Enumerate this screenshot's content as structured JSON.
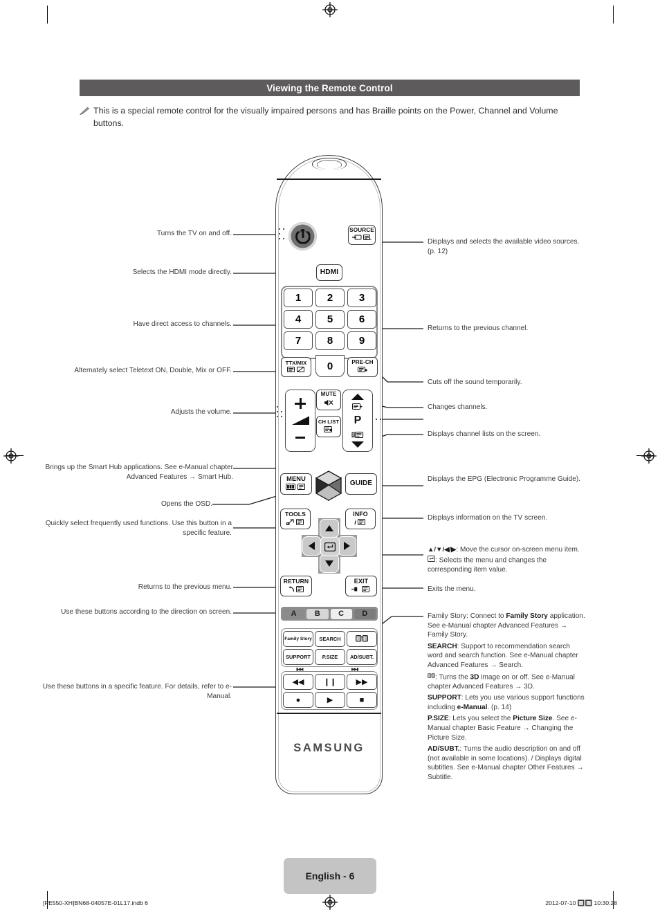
{
  "header": {
    "title": "Viewing the Remote Control"
  },
  "note": {
    "icon": "pencil-note-icon",
    "text": "This is a special remote control for the visually impaired persons and has Braille points on the Power, Channel and Volume buttons."
  },
  "labels_left": [
    {
      "id": "power",
      "text": "Turns the TV on and off."
    },
    {
      "id": "hdmi",
      "text": "Selects the HDMI mode directly."
    },
    {
      "id": "numbers",
      "text": "Have direct access to channels."
    },
    {
      "id": "ttxmix",
      "text": "Alternately select Teletext ON, Double, Mix or OFF."
    },
    {
      "id": "volume",
      "text": "Adjusts the volume."
    },
    {
      "id": "smarthub",
      "text": "Brings up the Smart Hub applications. See e-Manual chapter Advanced Features → Smart Hub."
    },
    {
      "id": "menu",
      "text": "Opens the OSD."
    },
    {
      "id": "tools",
      "text": "Quickly select frequently used functions. Use this button in a specific feature."
    },
    {
      "id": "return",
      "text": "Returns to the previous menu."
    },
    {
      "id": "colour",
      "text": "Use these buttons according to the direction on screen."
    },
    {
      "id": "media",
      "text": "Use these buttons in a specific feature. For details, refer to e-Manual."
    }
  ],
  "labels_right": [
    {
      "id": "source",
      "text": "Displays and selects the available video sources. (p. 12)"
    },
    {
      "id": "prech",
      "text": "Returns to the previous channel."
    },
    {
      "id": "mute",
      "text": "Cuts off the sound temporarily."
    },
    {
      "id": "channel",
      "text": "Changes channels."
    },
    {
      "id": "chlist",
      "text": "Displays channel lists on the screen."
    },
    {
      "id": "guide",
      "text": "Displays the EPG (Electronic Programme Guide)."
    },
    {
      "id": "info",
      "text": "Displays information on the TV screen."
    }
  ],
  "dpad_note": {
    "line1_prefix": "▲/▼/◀/▶",
    "line1": ": Move the cursor on-screen menu item.",
    "line2": ": Selects the menu and changes the corresponding item value.",
    "line2_icon": "enter-key-icon"
  },
  "exit_note": {
    "text": "Exits the menu."
  },
  "function_notes": [
    {
      "id": "family-story",
      "segments": [
        {
          "t": "Family Story: Connect to ",
          "b": false
        },
        {
          "t": "Family Story",
          "b": true
        },
        {
          "t": " application. See e-Manual chapter Advanced Features → Family Story.",
          "b": false
        }
      ]
    },
    {
      "id": "search",
      "segments": [
        {
          "t": "SEARCH",
          "b": true
        },
        {
          "t": ": Support to recommendation search word and search function. See e-Manual chapter Advanced Features → Search.",
          "b": false
        }
      ]
    },
    {
      "id": "3d",
      "segments": [
        {
          "t": "▨",
          "b": false
        },
        {
          "t": ": Turns the ",
          "b": false
        },
        {
          "t": "3D",
          "b": true
        },
        {
          "t": " image on or off. See e-Manual chapter Advanced Features → 3D.",
          "b": false
        }
      ]
    },
    {
      "id": "support",
      "segments": [
        {
          "t": "SUPPORT",
          "b": true
        },
        {
          "t": ": Lets you use various support functions including ",
          "b": false
        },
        {
          "t": "e-Manual",
          "b": true
        },
        {
          "t": ". (p. 14)",
          "b": false
        }
      ]
    },
    {
      "id": "psize",
      "segments": [
        {
          "t": "P.SIZE",
          "b": true
        },
        {
          "t": ": Lets you select the ",
          "b": false
        },
        {
          "t": "Picture Size",
          "b": true
        },
        {
          "t": ". See e-Manual chapter Basic Feature → Changing the Picture Size.",
          "b": false
        }
      ]
    },
    {
      "id": "adsubt",
      "segments": [
        {
          "t": "AD/SUBT.",
          "b": true
        },
        {
          "t": ": Turns the audio description on and off (not available in some locations). / Displays digital subtitles. See e-Manual chapter Other Features → Subtitle.",
          "b": false
        }
      ]
    }
  ],
  "remote": {
    "brand": "SAMSUNG",
    "power_icon": "power-icon",
    "hub_icon": "smart-hub-cube-icon",
    "keys": {
      "source": {
        "label": "SOURCE",
        "icons": [
          "input-arrow-icon",
          "teletext-icon"
        ]
      },
      "hdmi": {
        "label": "HDMI"
      },
      "ttxmix": {
        "label": "TTX/MIX",
        "icons": [
          "teletext-icon",
          "teletext-mix-icon"
        ]
      },
      "prech": {
        "label": "PRE-CH",
        "icons": [
          "prech-icon"
        ]
      },
      "mute": {
        "label": "MUTE",
        "icons": [
          "mute-speaker-icon"
        ]
      },
      "chlist": {
        "label": "CH LIST",
        "icons": [
          "ch-list-icon"
        ]
      },
      "menu": {
        "label": "MENU",
        "icons": [
          "menu-bars-icon",
          "teletext-icon"
        ]
      },
      "guide": {
        "label": "GUIDE"
      },
      "tools": {
        "label": "TOOLS",
        "icons": [
          "tools-icon",
          "teletext-icon"
        ]
      },
      "info": {
        "label": "INFO",
        "icons": [
          "info-i-icon",
          "teletext-icon"
        ]
      },
      "return": {
        "label": "RETURN",
        "icons": [
          "return-arrow-icon",
          "teletext-icon"
        ]
      },
      "exit": {
        "label": "EXIT",
        "icons": [
          "exit-icon",
          "teletext-icon"
        ]
      },
      "channel_letter": "P"
    },
    "numbers": [
      "1",
      "2",
      "3",
      "4",
      "5",
      "6",
      "7",
      "8",
      "9",
      "0"
    ],
    "colour_buttons": [
      {
        "label": "A",
        "color": "#8b8b8b"
      },
      {
        "label": "B",
        "color": "#d6d6d6"
      },
      {
        "label": "C",
        "color": "#efefef"
      },
      {
        "label": "D",
        "color": "#7c7c7c"
      }
    ],
    "function_keys": [
      {
        "label": "Family Story"
      },
      {
        "label": "SEARCH"
      },
      {
        "label": "3D",
        "icon": "3d-glasses-icon"
      },
      {
        "label": "SUPPORT"
      },
      {
        "label": "P.SIZE"
      },
      {
        "label": "AD/SUBT."
      }
    ],
    "media_keys": [
      {
        "label": "◀◀",
        "name": "rewind-icon"
      },
      {
        "label": "❙❙",
        "name": "pause-icon"
      },
      {
        "label": "▶▶",
        "name": "fast-forward-icon"
      },
      {
        "label": "●",
        "name": "record-icon"
      },
      {
        "label": "▶",
        "name": "play-icon"
      },
      {
        "label": "■",
        "name": "stop-icon"
      }
    ]
  },
  "footer": {
    "page_badge": "English - 6",
    "file_ref": "[PE550-XH]BN68-04057E-01L17.indb   6",
    "timestamp": "2012-07-10   🔲🔲 10:30:28"
  },
  "colors": {
    "header_bg": "#5d5b5c",
    "badge_bg": "#c4c4c4",
    "text": "#3a3a3a"
  }
}
